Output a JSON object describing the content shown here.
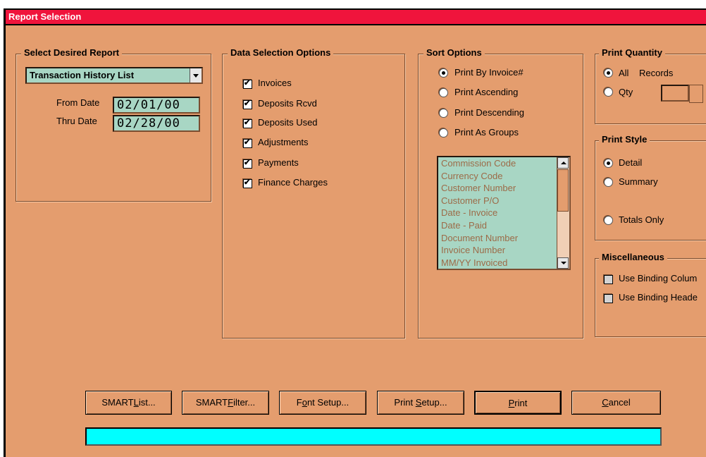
{
  "window": {
    "title": "Report Selection"
  },
  "report_group": {
    "title": "Select Desired Report",
    "selected_report": "Transaction History List",
    "from_label": "From Date",
    "from_value": "02/01/00",
    "thru_label": "Thru Date",
    "thru_value": "02/28/00"
  },
  "data_selection": {
    "title": "Data Selection Options",
    "items": [
      {
        "label": "Invoices",
        "checked": true
      },
      {
        "label": "Deposits Rcvd",
        "checked": true
      },
      {
        "label": "Deposits Used",
        "checked": true
      },
      {
        "label": "Adjustments",
        "checked": true
      },
      {
        "label": "Payments",
        "checked": true
      },
      {
        "label": "Finance Charges",
        "checked": true
      }
    ]
  },
  "sort_options": {
    "title": "Sort Options",
    "radios": [
      {
        "label": "Print By Invoice#",
        "selected": true
      },
      {
        "label": "Print Ascending",
        "selected": false
      },
      {
        "label": "Print Descending",
        "selected": false
      },
      {
        "label": "Print As Groups",
        "selected": false
      }
    ],
    "list_items": [
      "Commission Code",
      "Currency Code",
      "Customer Number",
      "Customer P/O",
      "Date - Invoice",
      "Date - Paid",
      "Document Number",
      "Invoice Number",
      "MM/YY Invoiced"
    ]
  },
  "print_quantity": {
    "title": "Print Quantity",
    "all_label": "All",
    "records_label": "Records",
    "qty_label": "Qty",
    "all_selected": true
  },
  "print_style": {
    "title": "Print Style",
    "options": [
      {
        "label": "Detail",
        "selected": true
      },
      {
        "label": "Summary",
        "selected": false
      },
      {
        "label": "Totals Only",
        "selected": false
      }
    ]
  },
  "miscellaneous": {
    "title": "Miscellaneous",
    "items": [
      {
        "label": "Use Binding Colum",
        "checked": false
      },
      {
        "label": "Use Binding Heade",
        "checked": false
      }
    ]
  },
  "buttons": {
    "smartlist": {
      "pre": "SMART",
      "u": "L",
      "post": "ist..."
    },
    "smartfilter": {
      "pre": "SMART",
      "u": "F",
      "post": "ilter..."
    },
    "font_setup": {
      "pre": "F",
      "u": "o",
      "post": "nt Setup..."
    },
    "print_setup": {
      "pre": "Print ",
      "u": "S",
      "post": "etup..."
    },
    "print": {
      "pre": "",
      "u": "P",
      "post": "rint"
    },
    "cancel": {
      "pre": "",
      "u": "C",
      "post": "ancel"
    }
  },
  "colors": {
    "title_bar": "#f0143c",
    "dialog_bg": "#e49d6e",
    "field_bg": "#a8d6c4",
    "progress": "#00ffff"
  }
}
